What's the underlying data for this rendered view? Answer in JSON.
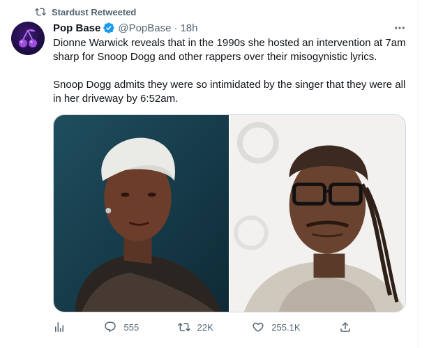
{
  "retweet": {
    "label": "Stardust Retweeted",
    "icon": "retweet-icon"
  },
  "author": {
    "name": "Pop Base",
    "handle": "@PopBase",
    "separator": "·",
    "time": "18h",
    "verified": true,
    "avatar_icon": "cherry-icon"
  },
  "tweet": {
    "paragraph1": "Dionne Warwick reveals that in the 1990s she hosted an intervention at 7am sharp for Snoop Dogg and other rappers over their misogynistic lyrics.",
    "paragraph2": "Snoop Dogg admits they were so intimidated by the singer that they were all in her driveway by 6:52am."
  },
  "actions": {
    "analytics_icon": "analytics-icon",
    "replies": "555",
    "retweets": "22K",
    "likes": "255.1K",
    "share_icon": "share-icon"
  },
  "colors": {
    "accent": "#1d9bf0",
    "secondary_text": "#536471",
    "border": "#cfd9de"
  }
}
